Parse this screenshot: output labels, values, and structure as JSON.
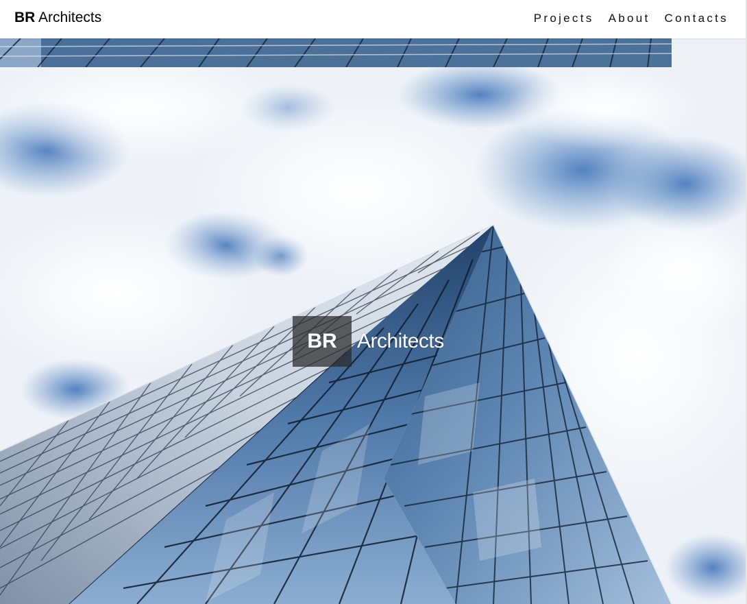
{
  "nav": {
    "brand_bold": "BR",
    "brand_rest": "Architects",
    "links": [
      {
        "label": "Projects"
      },
      {
        "label": "About"
      },
      {
        "label": "Contacts"
      }
    ]
  },
  "hero": {
    "title_badge": "BR",
    "title_word": "Architects",
    "image": "glass-skyscraper-against-cloudy-sky"
  },
  "colors": {
    "nav_background": "#ffffff",
    "nav_text": "#111111",
    "sky": "#f4f6f9",
    "sky_blue": "#4f7fb9",
    "glass_dark": "#23466f",
    "glass_light": "#b9cfe6",
    "badge_background": "#282828"
  }
}
